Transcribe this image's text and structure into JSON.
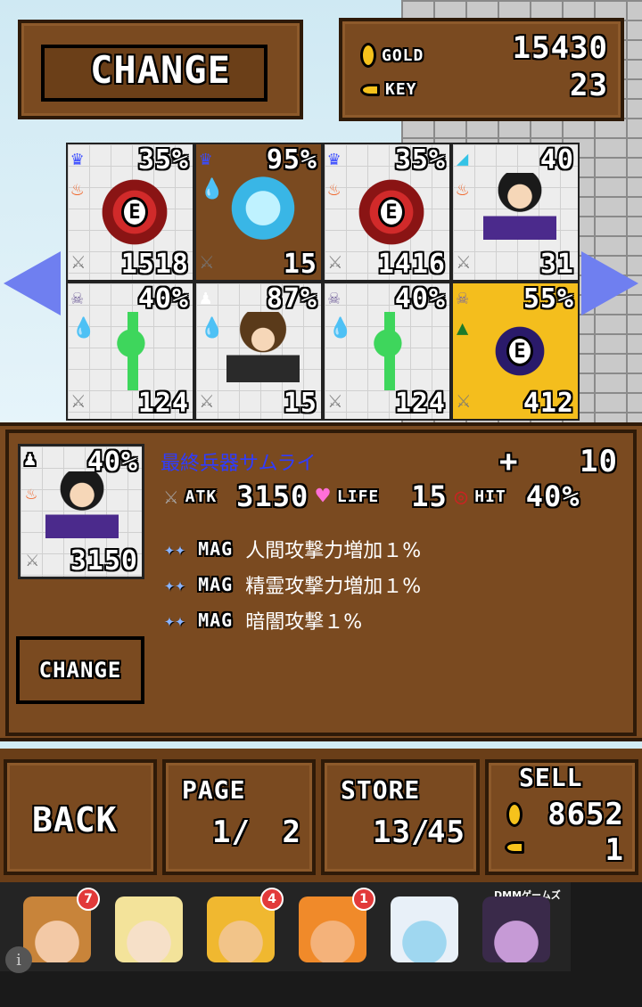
{
  "header": {
    "change_label": "CHANGE",
    "gold_label": "GOLD",
    "key_label": "KEY",
    "gold_value": "15430",
    "key_value": "23"
  },
  "grid": {
    "items": [
      {
        "pct": "35%",
        "value": "1518",
        "badge": "E",
        "sprite": "red",
        "bg": "white",
        "top_icon": "crown-icon",
        "elem_icon": "fire-icon"
      },
      {
        "pct": "95%",
        "value": "15",
        "badge": "",
        "sprite": "ice",
        "bg": "brown",
        "top_icon": "crown-icon",
        "elem_icon": "water-icon"
      },
      {
        "pct": "35%",
        "value": "1416",
        "badge": "E",
        "sprite": "red",
        "bg": "white",
        "top_icon": "crown-icon",
        "elem_icon": "fire-icon"
      },
      {
        "pct": "40",
        "value": "31",
        "badge": "",
        "sprite": "girl",
        "bg": "white",
        "top_icon": "corner-icon",
        "elem_icon": "fire-icon"
      },
      {
        "pct": "40%",
        "value": "124",
        "badge": "",
        "sprite": "green",
        "bg": "white",
        "top_icon": "skull-icon",
        "elem_icon": "water-icon"
      },
      {
        "pct": "87%",
        "value": "15",
        "badge": "",
        "sprite": "boy",
        "bg": "white",
        "top_icon": "person-icon",
        "elem_icon": "water-icon"
      },
      {
        "pct": "40%",
        "value": "124",
        "badge": "",
        "sprite": "green",
        "bg": "white",
        "top_icon": "skull-icon",
        "elem_icon": "water-icon"
      },
      {
        "pct": "55%",
        "value": "412",
        "badge": "E",
        "sprite": "dark",
        "bg": "yellow",
        "top_icon": "skull-icon",
        "elem_icon": "tree-icon"
      }
    ]
  },
  "detail": {
    "pct": "40%",
    "value": "3150",
    "name": "最終兵器サムライ",
    "plus_symbol": "+",
    "plus_value": "10",
    "atk_label": "ATK",
    "atk_value": "3150",
    "life_label": "LIFE",
    "life_value": "15",
    "hit_label": "HIT",
    "hit_value": "40%",
    "mag_label": "MAG",
    "mags": [
      "人間攻撃力増加１%",
      "精霊攻撃力増加１%",
      "暗闇攻撃１%"
    ],
    "change_label": "CHANGE"
  },
  "bottom": {
    "back_label": "BACK",
    "page_label": "PAGE",
    "page_current": "1/",
    "page_total": "2",
    "store_label": "STORE",
    "store_current": "13/",
    "store_total": "45",
    "sell_label": "SELL",
    "sell_gold": "8652",
    "sell_key": "1"
  },
  "ads": {
    "brand": "DMMゲームズ",
    "badges": [
      "7",
      "",
      "4",
      "1",
      "",
      ""
    ]
  }
}
